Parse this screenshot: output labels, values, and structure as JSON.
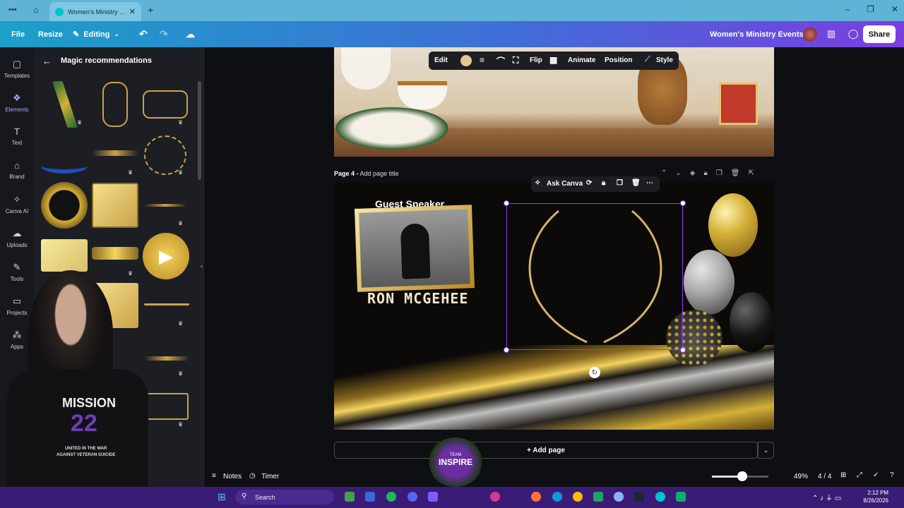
{
  "browser": {
    "tab_title": "Women's Ministry ...",
    "new_tab_icon": "plus-icon",
    "window_controls": [
      "minimize-icon",
      "maximize-icon",
      "close-icon"
    ]
  },
  "topbar": {
    "file": "File",
    "resize": "Resize",
    "editing": "Editing",
    "project_title": "Women's Ministry Events",
    "share": "Share"
  },
  "rail": {
    "items": [
      {
        "label": "Templates",
        "icon": "templates-icon"
      },
      {
        "label": "Elements",
        "icon": "elements-icon"
      },
      {
        "label": "Text",
        "icon": "text-icon"
      },
      {
        "label": "Brand",
        "icon": "brand-icon"
      },
      {
        "label": "Canva AI",
        "icon": "canva-ai-icon"
      },
      {
        "label": "Uploads",
        "icon": "uploads-icon"
      },
      {
        "label": "Tools",
        "icon": "tools-icon"
      },
      {
        "label": "Projects",
        "icon": "projects-icon"
      },
      {
        "label": "Apps",
        "icon": "apps-icon"
      }
    ]
  },
  "panel": {
    "title": "Magic recommendations"
  },
  "element_toolbar": {
    "edit": "Edit",
    "flip": "Flip",
    "animate": "Animate",
    "position": "Position",
    "style": "Style"
  },
  "page4": {
    "label": "Page 4 -",
    "add_title": "Add page title",
    "guest_speaker": "Guest Speaker",
    "speaker_name": "RON MCGEHEE"
  },
  "context_menu": {
    "ask_canva": "Ask Canva"
  },
  "canvas": {
    "add_page": "+ Add page"
  },
  "bottom": {
    "notes": "Notes",
    "timer": "Timer",
    "zoom": "49%",
    "zoom_level": 0.49,
    "pages": "4 / 4"
  },
  "overlay": {
    "shirt_line1": "MISSION",
    "shirt_line2": "22",
    "shirt_line3": "UNITED IN THE WAR",
    "shirt_line4": "AGAINST VETERAN SUICIDE",
    "badge_line1": "TEAM",
    "badge_line2": "INSPIRE"
  },
  "taskbar": {
    "search": "Search",
    "time": "2:12 PM",
    "date": "8/26/2026"
  },
  "colors": {
    "accent": "#8b3dff",
    "gold": "#d4af37",
    "taskbar": "#3a1c76"
  }
}
